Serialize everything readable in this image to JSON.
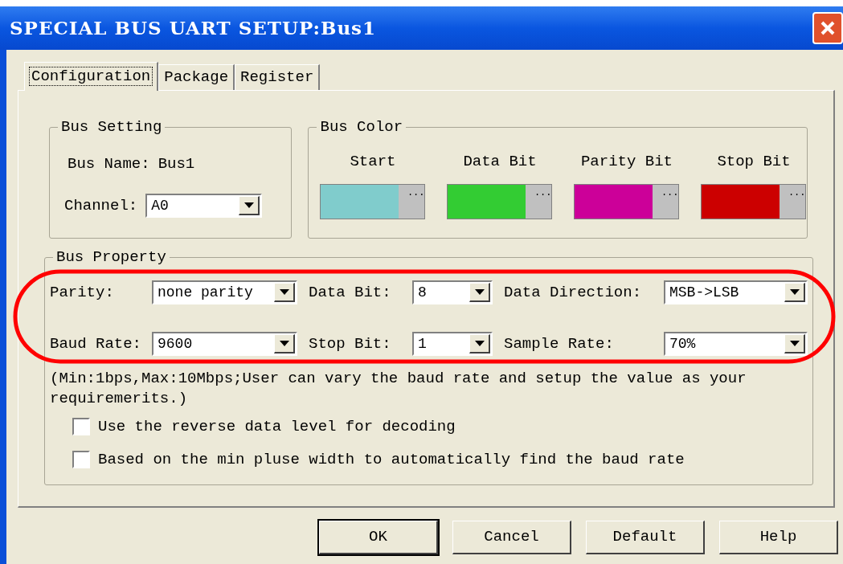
{
  "window": {
    "title": "SPECIAL BUS UART SETUP:Bus1"
  },
  "tabs": [
    {
      "label": "Configuration",
      "selected": true
    },
    {
      "label": "Package",
      "selected": false
    },
    {
      "label": "Register",
      "selected": false
    }
  ],
  "bus_setting": {
    "title": "Bus Setting",
    "name_label": "Bus Name:",
    "name_value": "Bus1",
    "channel_label": "Channel:",
    "channel_value": "A0"
  },
  "bus_color": {
    "title": "Bus Color",
    "items": [
      {
        "label": "Start",
        "color": "#80cccc",
        "button": "..."
      },
      {
        "label": "Data Bit",
        "color": "#33cc33",
        "button": "..."
      },
      {
        "label": "Parity Bit",
        "color": "#cc0099",
        "button": "..."
      },
      {
        "label": "Stop Bit",
        "color": "#cc0000",
        "button": "..."
      }
    ]
  },
  "bus_property": {
    "title": "Bus Property",
    "fields": [
      {
        "label": "Parity:",
        "value": "none parity"
      },
      {
        "label": "Data Bit:",
        "value": "8"
      },
      {
        "label": "Data Direction:",
        "value": "MSB->LSB"
      },
      {
        "label": "Baud Rate:",
        "value": "9600"
      },
      {
        "label": "Stop Bit:",
        "value": "1"
      },
      {
        "label": "Sample Rate:",
        "value": "70%"
      }
    ],
    "note": "(Min:1bps,Max:10Mbps;User can vary the baud rate and setup the value as your requiremerits.)",
    "checkboxes": [
      {
        "label": "Use the reverse data level for decoding",
        "checked": false
      },
      {
        "label": "Based on the min pluse width to automatically find the baud rate",
        "checked": false
      }
    ]
  },
  "buttons": [
    {
      "label": "OK",
      "default": true
    },
    {
      "label": "Cancel",
      "default": false
    },
    {
      "label": "Default",
      "default": false
    },
    {
      "label": "Help",
      "default": false
    }
  ]
}
